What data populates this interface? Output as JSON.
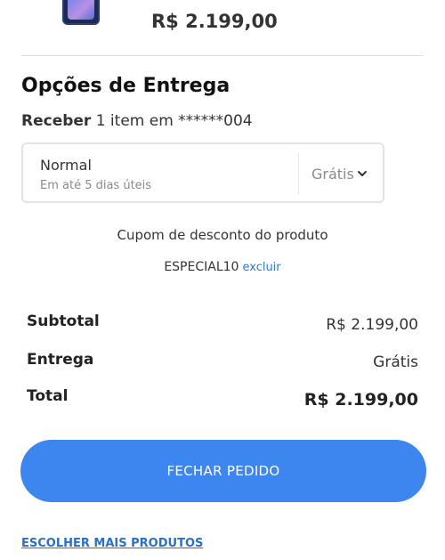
{
  "product": {
    "price": "R$ 2.199,00"
  },
  "delivery": {
    "section_title": "Opções de Entrega",
    "receive_prefix": "Receber",
    "receive_rest": " 1 item em ******004",
    "option": {
      "method": "Normal",
      "eta": "Em até 5 dias úteis",
      "cost": "Grátis"
    }
  },
  "coupon": {
    "title": "Cupom de desconto do produto",
    "code": "ESPECIAL10",
    "remove_label": "excluir"
  },
  "summary": {
    "subtotal_label": "Subtotal",
    "subtotal_value": "R$ 2.199,00",
    "shipping_label": "Entrega",
    "shipping_value": "Grátis",
    "total_label": "Total",
    "total_value": "R$ 2.199,00"
  },
  "actions": {
    "checkout_label": "FECHAR PEDIDO",
    "more_products_label": "ESCOLHER MAIS PRODUTOS"
  },
  "colors": {
    "primary_button": "#3d86f0",
    "link": "#2a7bd3"
  }
}
